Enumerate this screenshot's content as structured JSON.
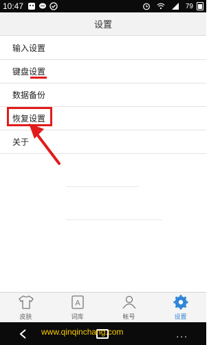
{
  "status_bar": {
    "time": "10:47",
    "battery": "79",
    "icons": [
      "android-icon",
      "message-icon",
      "check-icon",
      "alarm-icon",
      "wifi-icon",
      "signal-icon",
      "battery-icon"
    ]
  },
  "header": {
    "title": "设置"
  },
  "menu": {
    "items": [
      {
        "label": "输入设置"
      },
      {
        "label": "键盘设置"
      },
      {
        "label": "数据备份"
      },
      {
        "label": "恢复设置"
      },
      {
        "label": "关于"
      }
    ]
  },
  "tabbar": {
    "tabs": [
      {
        "label": "皮肤",
        "icon": "tshirt-icon"
      },
      {
        "label": "词库",
        "icon": "letter-a-icon"
      },
      {
        "label": "帐号",
        "icon": "user-icon"
      },
      {
        "label": "设置",
        "icon": "gear-icon",
        "active": true
      }
    ],
    "active_color": "#2f86d6"
  },
  "watermark": "www.qinqinchang.com",
  "nav": {
    "menu": "..."
  },
  "annotations": {
    "highlight_color": "#e21b1b"
  }
}
